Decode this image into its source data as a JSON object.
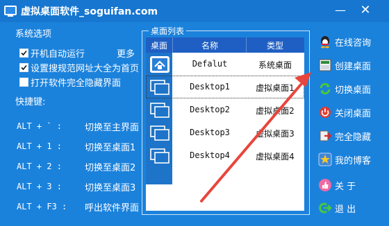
{
  "window": {
    "title": "虚拟桌面软件_soguifan.com",
    "min_label": "—",
    "close_label": "✕"
  },
  "options": {
    "section_title": "系统选项",
    "more_label": "更多",
    "checkboxes": [
      {
        "label": "开机自动运行",
        "checked": true
      },
      {
        "label": "设置搜规范网址大全为首页",
        "checked": true
      },
      {
        "label": "打开软件完全隐藏界面",
        "checked": false
      }
    ]
  },
  "hotkeys": {
    "title": "快捷键:",
    "items": [
      {
        "keys": "ALT  +  `  :",
        "action": "切换至主界面"
      },
      {
        "keys": "ALT  +  1  :",
        "action": "切换至桌面1"
      },
      {
        "keys": "ALT  +  2  :",
        "action": "切换至桌面2"
      },
      {
        "keys": "ALT  +  3  :",
        "action": "切换至桌面3"
      },
      {
        "keys": "ALT  + F3  :",
        "action": "呼出软件界面"
      }
    ]
  },
  "desktop_list": {
    "group_title": "桌面列表",
    "columns": [
      "桌面",
      "名称",
      "类型"
    ],
    "rows": [
      {
        "name": "Defalut",
        "type": "系统桌面",
        "selected": false
      },
      {
        "name": "Desktop1",
        "type": "虚拟桌面1",
        "selected": true
      },
      {
        "name": "Desktop2",
        "type": "虚拟桌面2",
        "selected": false
      },
      {
        "name": "Desktop3",
        "type": "虚拟桌面3",
        "selected": false
      },
      {
        "name": "Desktop4",
        "type": "虚拟桌面4",
        "selected": false
      }
    ]
  },
  "side_menu": [
    {
      "label": "在线咨询",
      "icon": "qq-penguin-icon"
    },
    {
      "label": "创建桌面",
      "icon": "create-desktop-icon"
    },
    {
      "label": "切换桌面",
      "icon": "switch-arrows-icon"
    },
    {
      "label": "关闭桌面",
      "icon": "power-icon"
    },
    {
      "label": "完全隐藏",
      "icon": "hide-icon"
    },
    {
      "label": "我的博客",
      "icon": "star-icon"
    },
    {
      "label": "关      于",
      "icon": "thumb-icon"
    },
    {
      "label": "退      出",
      "icon": "exit-icon"
    }
  ],
  "colors": {
    "background": "#1b82dc",
    "header": "#1f5fc3",
    "arrow": "#e8453c"
  }
}
